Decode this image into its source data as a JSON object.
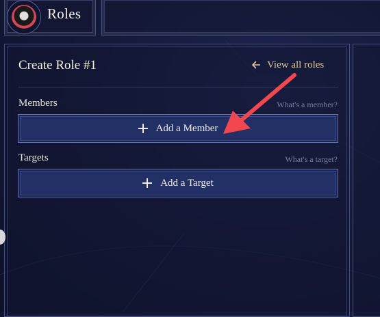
{
  "header": {
    "title": "Roles",
    "avatar_icon": "guild-avatar-icon"
  },
  "panel": {
    "title": "Create Role #1",
    "view_all_label": "View all roles"
  },
  "members": {
    "label": "Members",
    "help_link": "What's a member?",
    "add_button": "Add a Member"
  },
  "targets": {
    "label": "Targets",
    "help_link": "What's a target?",
    "add_button": "Add a Target"
  },
  "colors": {
    "accent_gold": "#d8c79a",
    "button_bg": "#223066",
    "annotation_arrow": "#f0484e"
  }
}
